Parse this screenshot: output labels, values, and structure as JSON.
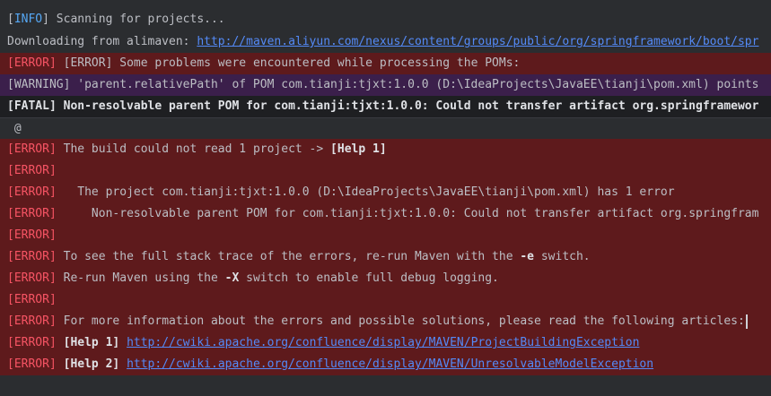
{
  "console": {
    "l1": {
      "tag": "[INFO]",
      "text": " Scanning for projects..."
    },
    "l2": {
      "text": "Downloading from alimaven: ",
      "url": "http://maven.aliyun.com/nexus/content/groups/public/org/springframework/boot/spr"
    },
    "l3": {
      "tag": "[ERROR]",
      "text": " [ERROR] Some problems were encountered while processing the POMs:"
    },
    "l4": {
      "text": "[WARNING] 'parent.relativePath' of POM com.tianji:tjxt:1.0.0 (D:\\IdeaProjects\\JavaEE\\tianji\\pom.xml) points"
    },
    "l5": {
      "text": "[FATAL] Non-resolvable parent POM for com.tianji:tjxt:1.0.0: Could not transfer artifact org.springframewor"
    },
    "l6": {
      "text": " @"
    },
    "l7": {
      "tag": "[ERROR]",
      "text": " The build could not read 1 project -> ",
      "bold": "[Help 1]"
    },
    "l8": {
      "tag": "[ERROR]"
    },
    "l9": {
      "tag": "[ERROR]",
      "text": "   The project com.tianji:tjxt:1.0.0 (D:\\IdeaProjects\\JavaEE\\tianji\\pom.xml) has 1 error"
    },
    "l10": {
      "tag": "[ERROR]",
      "text": "     Non-resolvable parent POM for com.tianji:tjxt:1.0.0: Could not transfer artifact org.springfram"
    },
    "l11": {
      "tag": "[ERROR]"
    },
    "l12": {
      "tag": "[ERROR]",
      "text1": " To see the full stack trace of the errors, re-run Maven with the ",
      "bold": "-e",
      "text2": " switch."
    },
    "l13": {
      "tag": "[ERROR]",
      "text1": " Re-run Maven using the ",
      "bold": "-X",
      "text2": " switch to enable full debug logging."
    },
    "l14": {
      "tag": "[ERROR]"
    },
    "l15": {
      "tag": "[ERROR]",
      "text": " For more information about the errors and possible solutions, please read the following articles:"
    },
    "l16": {
      "tag": "[ERROR]",
      "bold": " [Help 1] ",
      "url": "http://cwiki.apache.org/confluence/display/MAVEN/ProjectBuildingException"
    },
    "l17": {
      "tag": "[ERROR]",
      "bold": " [Help 2] ",
      "url": "http://cwiki.apache.org/confluence/display/MAVEN/UnresolvableModelException"
    }
  },
  "colors": {
    "background": "#2b2d30",
    "error_row": "#5e1a1c",
    "warning_row": "#3b1f4b",
    "error_tag": "#f75464",
    "info_tag": "#56a8f5",
    "link": "#548af7"
  }
}
